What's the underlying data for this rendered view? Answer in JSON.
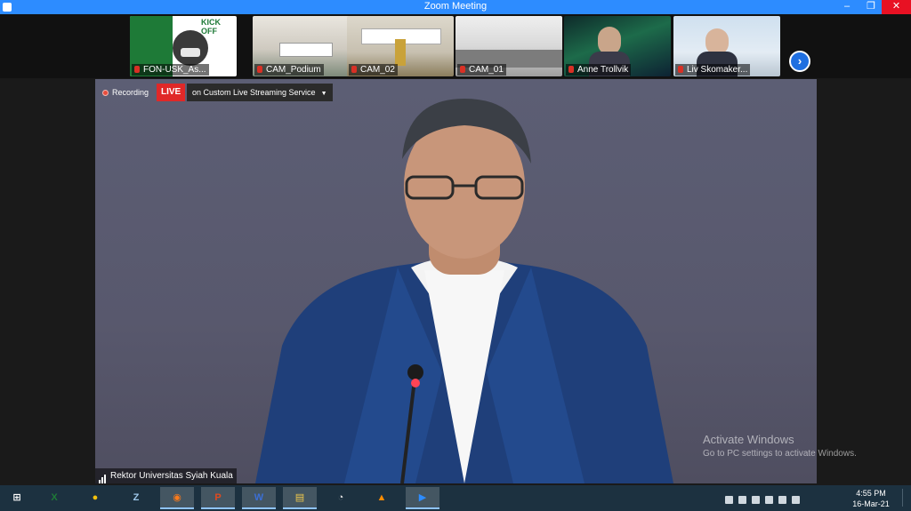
{
  "window": {
    "title": "Zoom Meeting",
    "controls": {
      "minimize": "–",
      "maximize": "❐",
      "close": "✕"
    }
  },
  "thumbnails": [
    {
      "name": "FON-USK_As...",
      "muted": true,
      "banner": "KICK OFF"
    },
    {
      "name": "CAM_Podium",
      "muted": true
    },
    {
      "name": "CAM_02",
      "muted": true
    },
    {
      "name": "CAM_01",
      "muted": true
    },
    {
      "name": "Anne Trollvik",
      "muted": true
    },
    {
      "name": "Liv Skomaker...",
      "muted": true
    }
  ],
  "next_button": "›",
  "recording": {
    "status": "Recording",
    "live_badge": "LIVE",
    "service": "on Custom Live Streaming Service"
  },
  "active_speaker": {
    "name": "Rektor Universitas Syiah Kuala"
  },
  "watermark": {
    "line1": "Activate Windows",
    "line2": "Go to PC settings to activate Windows."
  },
  "taskbar": {
    "apps": [
      {
        "name": "start",
        "glyph": "⊞"
      },
      {
        "name": "excel",
        "glyph": "X"
      },
      {
        "name": "chrome",
        "glyph": "●"
      },
      {
        "name": "zotero",
        "glyph": "Z"
      },
      {
        "name": "firefox",
        "glyph": "◉"
      },
      {
        "name": "powerpoint",
        "glyph": "P"
      },
      {
        "name": "word",
        "glyph": "W"
      },
      {
        "name": "file-explorer",
        "glyph": "▤"
      },
      {
        "name": "app-bubble",
        "glyph": "◔"
      },
      {
        "name": "vlc",
        "glyph": "▲"
      },
      {
        "name": "zoom",
        "glyph": "▶"
      }
    ],
    "clock": {
      "time": "4:55 PM",
      "date": "16-Mar-21"
    }
  },
  "colors": {
    "accent": "#2d8cff",
    "live": "#e02828",
    "taskbar": "#1c3140"
  }
}
